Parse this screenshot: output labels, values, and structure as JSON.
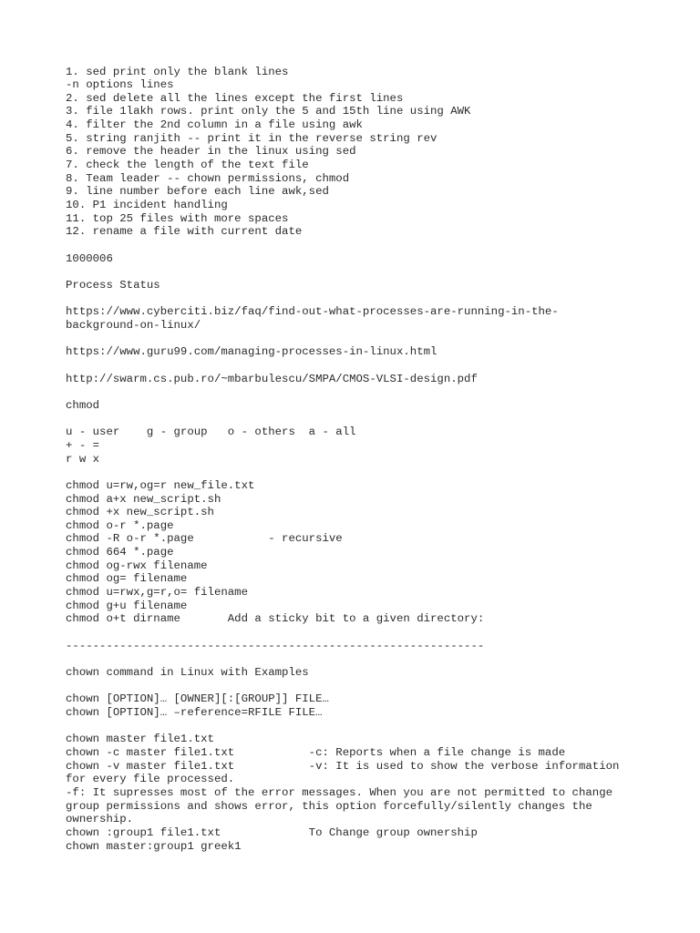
{
  "document": {
    "lines": [
      "1. sed print only the blank lines",
      "-n options lines",
      "2. sed delete all the lines except the first lines",
      "3. file 1lakh rows. print only the 5 and 15th line using AWK",
      "4. filter the 2nd column in a file using awk",
      "5. string ranjith -- print it in the reverse string rev",
      "6. remove the header in the linux using sed",
      "7. check the length of the text file",
      "8. Team leader -- chown permissions, chmod",
      "9. line number before each line awk,sed",
      "10. P1 incident handling",
      "11. top 25 files with more spaces",
      "12. rename a file with current date",
      "",
      "1000006",
      "",
      "Process Status",
      "",
      "https://www.cyberciti.biz/faq/find-out-what-processes-are-running-in-the-",
      "background-on-linux/",
      "",
      "https://www.guru99.com/managing-processes-in-linux.html",
      "",
      "http://swarm.cs.pub.ro/~mbarbulescu/SMPA/CMOS-VLSI-design.pdf",
      "",
      "chmod",
      "",
      "u - user    g - group   o - others  a - all",
      "+ - =",
      "r w x",
      "",
      "chmod u=rw,og=r new_file.txt",
      "chmod a+x new_script.sh",
      "chmod +x new_script.sh",
      "chmod o-r *.page",
      "chmod -R o-r *.page           - recursive",
      "chmod 664 *.page",
      "chmod og-rwx filename",
      "chmod og= filename",
      "chmod u=rwx,g=r,o= filename",
      "chmod g+u filename",
      "chmod o+t dirname       Add a sticky bit to a given directory:",
      "",
      "--------------------------------------------------------------",
      "",
      "chown command in Linux with Examples",
      "",
      "chown [OPTION]… [OWNER][:[GROUP]] FILE…",
      "chown [OPTION]… –reference=RFILE FILE…",
      "",
      "chown master file1.txt",
      "chown -c master file1.txt           -c: Reports when a file change is made",
      "chown -v master file1.txt           -v: It is used to show the verbose information",
      "for every file processed.",
      "-f: It supresses most of the error messages. When you are not permitted to change",
      "group permissions and shows error, this option forcefully/silently changes the",
      "ownership.",
      "chown :group1 file1.txt             To Change group ownership",
      "chown master:group1 greek1"
    ]
  }
}
